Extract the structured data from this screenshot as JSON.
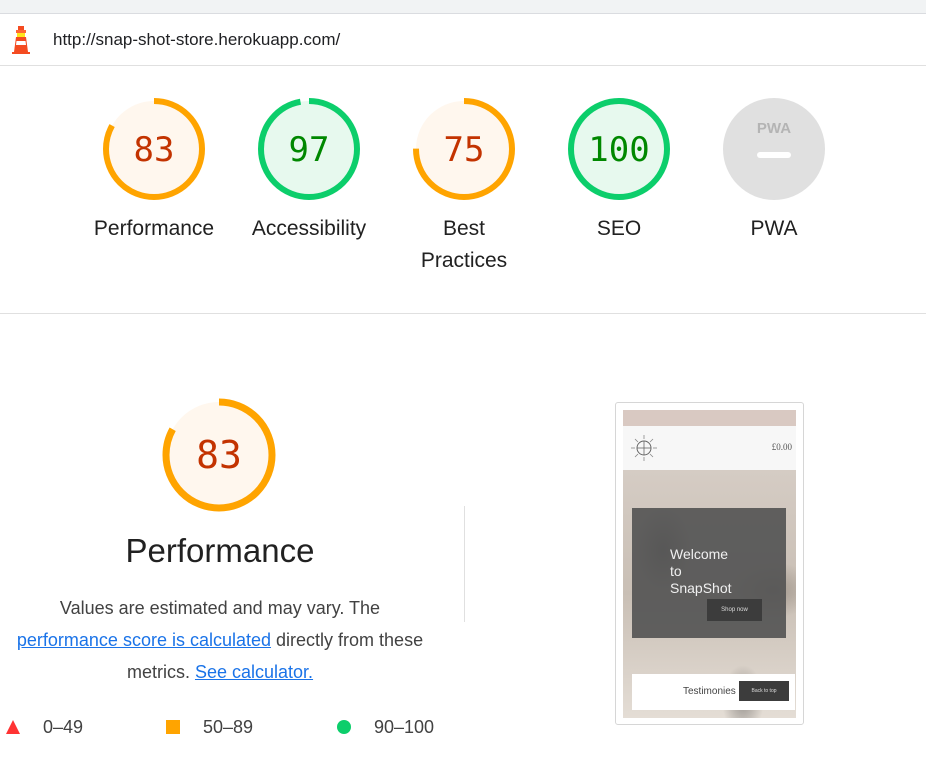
{
  "browser": {
    "url": "http://snap-shot-store.herokuapp.com/"
  },
  "summary_gauges": [
    {
      "id": "performance",
      "score": 83,
      "label": "Performance",
      "status": "average",
      "ring_color": "#ffa400",
      "fill_color": "#fff7ee",
      "text_color": "#c33300"
    },
    {
      "id": "accessibility",
      "score": 97,
      "label": "Accessibility",
      "status": "pass",
      "ring_color": "#0cce6b",
      "fill_color": "#e7f9ee",
      "text_color": "#008800"
    },
    {
      "id": "best-practices",
      "score": 75,
      "label": "Best Practices",
      "status": "average",
      "ring_color": "#ffa400",
      "fill_color": "#fff7ee",
      "text_color": "#c33300"
    },
    {
      "id": "seo",
      "score": 100,
      "label": "SEO",
      "status": "pass",
      "ring_color": "#0cce6b",
      "fill_color": "#e7f9ee",
      "text_color": "#008800"
    },
    {
      "id": "pwa",
      "score": null,
      "label": "PWA",
      "status": "n/a",
      "badge_text": "PWA",
      "fill_color": "#e0e0e0"
    }
  ],
  "performance": {
    "score": 83,
    "title": "Performance",
    "description_pre": "Values are estimated and may vary. The",
    "link_score_calculated": "performance score is calculated",
    "description_mid": "directly from these metrics.",
    "link_calculator": "See calculator."
  },
  "legend": [
    {
      "shape": "triangle",
      "color": "#ff3333",
      "range": "0–49"
    },
    {
      "shape": "square",
      "color": "#ffa400",
      "range": "50–89"
    },
    {
      "shape": "circle",
      "color": "#0cce6b",
      "range": "90–100"
    }
  ],
  "screenshot_thumbnail": {
    "price": "£0.00",
    "hero_line1": "Welcome",
    "hero_line2": "to",
    "hero_line3": "SnapShot",
    "shop_button": "Shop now",
    "footer_link": "Testimonies",
    "back_to_top": "Back to top"
  },
  "icons": [
    "lighthouse-logo-icon",
    "sun-logo-icon"
  ]
}
